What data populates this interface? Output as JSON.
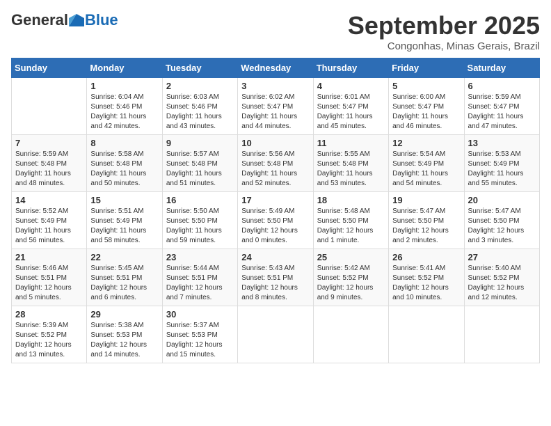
{
  "header": {
    "logo_general": "General",
    "logo_blue": "Blue",
    "month_title": "September 2025",
    "subtitle": "Congonhas, Minas Gerais, Brazil"
  },
  "weekdays": [
    "Sunday",
    "Monday",
    "Tuesday",
    "Wednesday",
    "Thursday",
    "Friday",
    "Saturday"
  ],
  "weeks": [
    [
      {
        "day": "",
        "info": ""
      },
      {
        "day": "1",
        "info": "Sunrise: 6:04 AM\nSunset: 5:46 PM\nDaylight: 11 hours\nand 42 minutes."
      },
      {
        "day": "2",
        "info": "Sunrise: 6:03 AM\nSunset: 5:46 PM\nDaylight: 11 hours\nand 43 minutes."
      },
      {
        "day": "3",
        "info": "Sunrise: 6:02 AM\nSunset: 5:47 PM\nDaylight: 11 hours\nand 44 minutes."
      },
      {
        "day": "4",
        "info": "Sunrise: 6:01 AM\nSunset: 5:47 PM\nDaylight: 11 hours\nand 45 minutes."
      },
      {
        "day": "5",
        "info": "Sunrise: 6:00 AM\nSunset: 5:47 PM\nDaylight: 11 hours\nand 46 minutes."
      },
      {
        "day": "6",
        "info": "Sunrise: 5:59 AM\nSunset: 5:47 PM\nDaylight: 11 hours\nand 47 minutes."
      }
    ],
    [
      {
        "day": "7",
        "info": "Sunrise: 5:59 AM\nSunset: 5:48 PM\nDaylight: 11 hours\nand 48 minutes."
      },
      {
        "day": "8",
        "info": "Sunrise: 5:58 AM\nSunset: 5:48 PM\nDaylight: 11 hours\nand 50 minutes."
      },
      {
        "day": "9",
        "info": "Sunrise: 5:57 AM\nSunset: 5:48 PM\nDaylight: 11 hours\nand 51 minutes."
      },
      {
        "day": "10",
        "info": "Sunrise: 5:56 AM\nSunset: 5:48 PM\nDaylight: 11 hours\nand 52 minutes."
      },
      {
        "day": "11",
        "info": "Sunrise: 5:55 AM\nSunset: 5:48 PM\nDaylight: 11 hours\nand 53 minutes."
      },
      {
        "day": "12",
        "info": "Sunrise: 5:54 AM\nSunset: 5:49 PM\nDaylight: 11 hours\nand 54 minutes."
      },
      {
        "day": "13",
        "info": "Sunrise: 5:53 AM\nSunset: 5:49 PM\nDaylight: 11 hours\nand 55 minutes."
      }
    ],
    [
      {
        "day": "14",
        "info": "Sunrise: 5:52 AM\nSunset: 5:49 PM\nDaylight: 11 hours\nand 56 minutes."
      },
      {
        "day": "15",
        "info": "Sunrise: 5:51 AM\nSunset: 5:49 PM\nDaylight: 11 hours\nand 58 minutes."
      },
      {
        "day": "16",
        "info": "Sunrise: 5:50 AM\nSunset: 5:50 PM\nDaylight: 11 hours\nand 59 minutes."
      },
      {
        "day": "17",
        "info": "Sunrise: 5:49 AM\nSunset: 5:50 PM\nDaylight: 12 hours\nand 0 minutes."
      },
      {
        "day": "18",
        "info": "Sunrise: 5:48 AM\nSunset: 5:50 PM\nDaylight: 12 hours\nand 1 minute."
      },
      {
        "day": "19",
        "info": "Sunrise: 5:47 AM\nSunset: 5:50 PM\nDaylight: 12 hours\nand 2 minutes."
      },
      {
        "day": "20",
        "info": "Sunrise: 5:47 AM\nSunset: 5:50 PM\nDaylight: 12 hours\nand 3 minutes."
      }
    ],
    [
      {
        "day": "21",
        "info": "Sunrise: 5:46 AM\nSunset: 5:51 PM\nDaylight: 12 hours\nand 5 minutes."
      },
      {
        "day": "22",
        "info": "Sunrise: 5:45 AM\nSunset: 5:51 PM\nDaylight: 12 hours\nand 6 minutes."
      },
      {
        "day": "23",
        "info": "Sunrise: 5:44 AM\nSunset: 5:51 PM\nDaylight: 12 hours\nand 7 minutes."
      },
      {
        "day": "24",
        "info": "Sunrise: 5:43 AM\nSunset: 5:51 PM\nDaylight: 12 hours\nand 8 minutes."
      },
      {
        "day": "25",
        "info": "Sunrise: 5:42 AM\nSunset: 5:52 PM\nDaylight: 12 hours\nand 9 minutes."
      },
      {
        "day": "26",
        "info": "Sunrise: 5:41 AM\nSunset: 5:52 PM\nDaylight: 12 hours\nand 10 minutes."
      },
      {
        "day": "27",
        "info": "Sunrise: 5:40 AM\nSunset: 5:52 PM\nDaylight: 12 hours\nand 12 minutes."
      }
    ],
    [
      {
        "day": "28",
        "info": "Sunrise: 5:39 AM\nSunset: 5:52 PM\nDaylight: 12 hours\nand 13 minutes."
      },
      {
        "day": "29",
        "info": "Sunrise: 5:38 AM\nSunset: 5:53 PM\nDaylight: 12 hours\nand 14 minutes."
      },
      {
        "day": "30",
        "info": "Sunrise: 5:37 AM\nSunset: 5:53 PM\nDaylight: 12 hours\nand 15 minutes."
      },
      {
        "day": "",
        "info": ""
      },
      {
        "day": "",
        "info": ""
      },
      {
        "day": "",
        "info": ""
      },
      {
        "day": "",
        "info": ""
      }
    ]
  ]
}
